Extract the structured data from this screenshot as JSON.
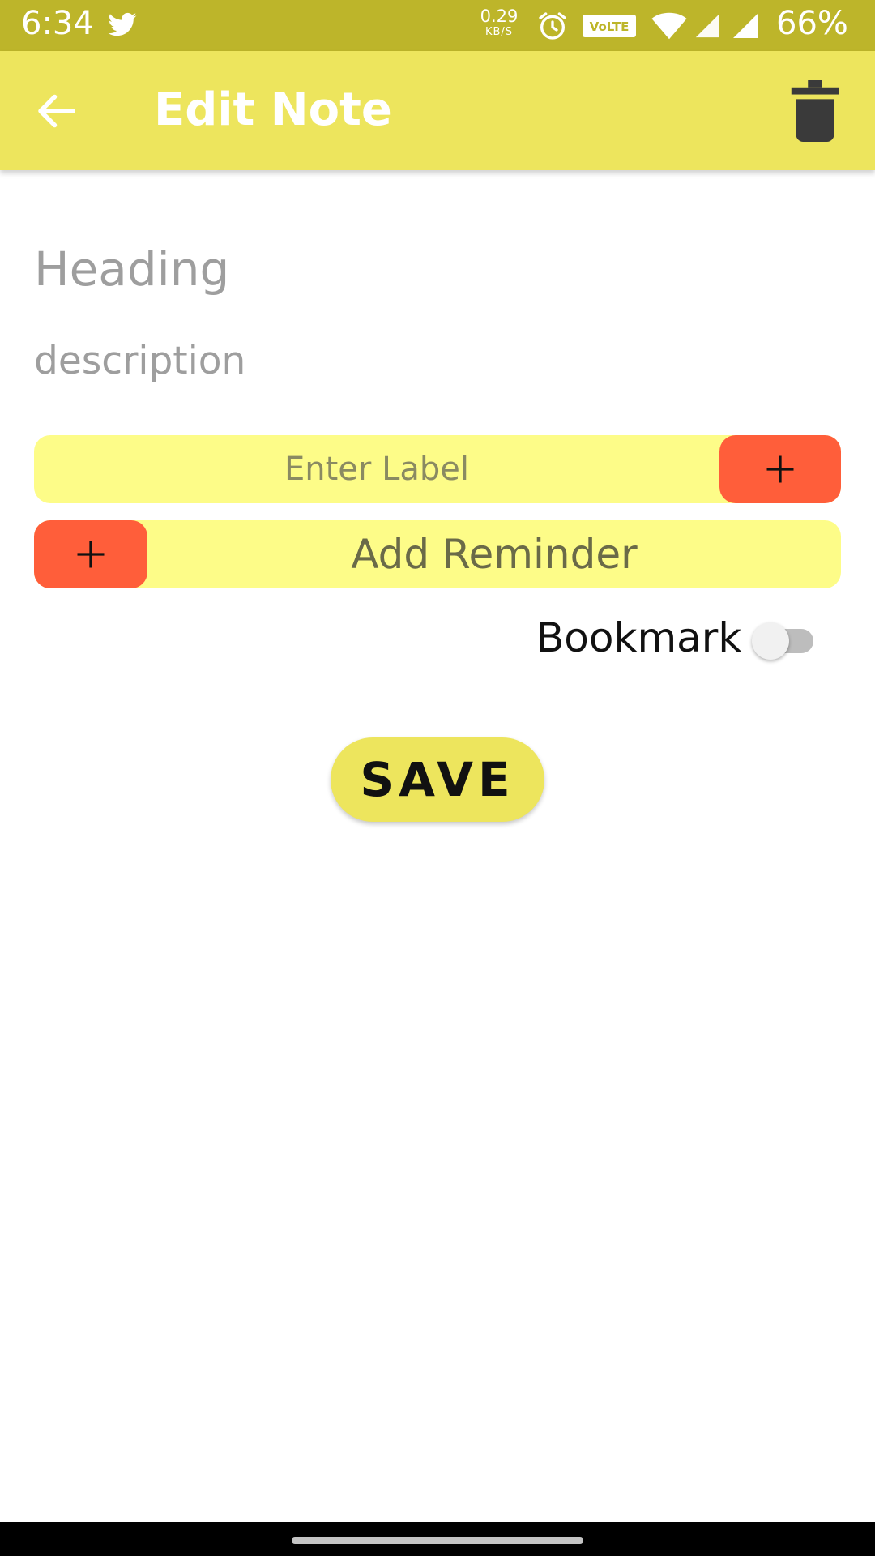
{
  "status_bar": {
    "time": "6:34",
    "net_speed_value": "0.29",
    "net_speed_unit": "KB/S",
    "volte": "VoLTE",
    "battery": "66%",
    "icons": [
      "twitter-icon",
      "alarm-icon",
      "volte-icon",
      "wifi-icon",
      "signal-icon",
      "signal-icon"
    ]
  },
  "app_bar": {
    "title": "Edit Note",
    "back_icon": "arrow-left-icon",
    "delete_icon": "trash-icon",
    "background_color": "#ede55d"
  },
  "form": {
    "heading_placeholder": "Heading",
    "heading_value": "",
    "description_placeholder": "description",
    "description_value": "",
    "label_placeholder": "Enter Label",
    "label_value": "",
    "label_add_icon": "plus-icon",
    "reminder_label": "Add Reminder",
    "reminder_add_icon": "plus-icon",
    "bookmark_label": "Bookmark",
    "bookmark_on": false,
    "save_label": "SAVE"
  },
  "colors": {
    "accent_yellow": "#ede55d",
    "field_yellow": "#fdfc88",
    "accent_orange": "#ff5e3a",
    "status_bar": "#bdb52a"
  }
}
